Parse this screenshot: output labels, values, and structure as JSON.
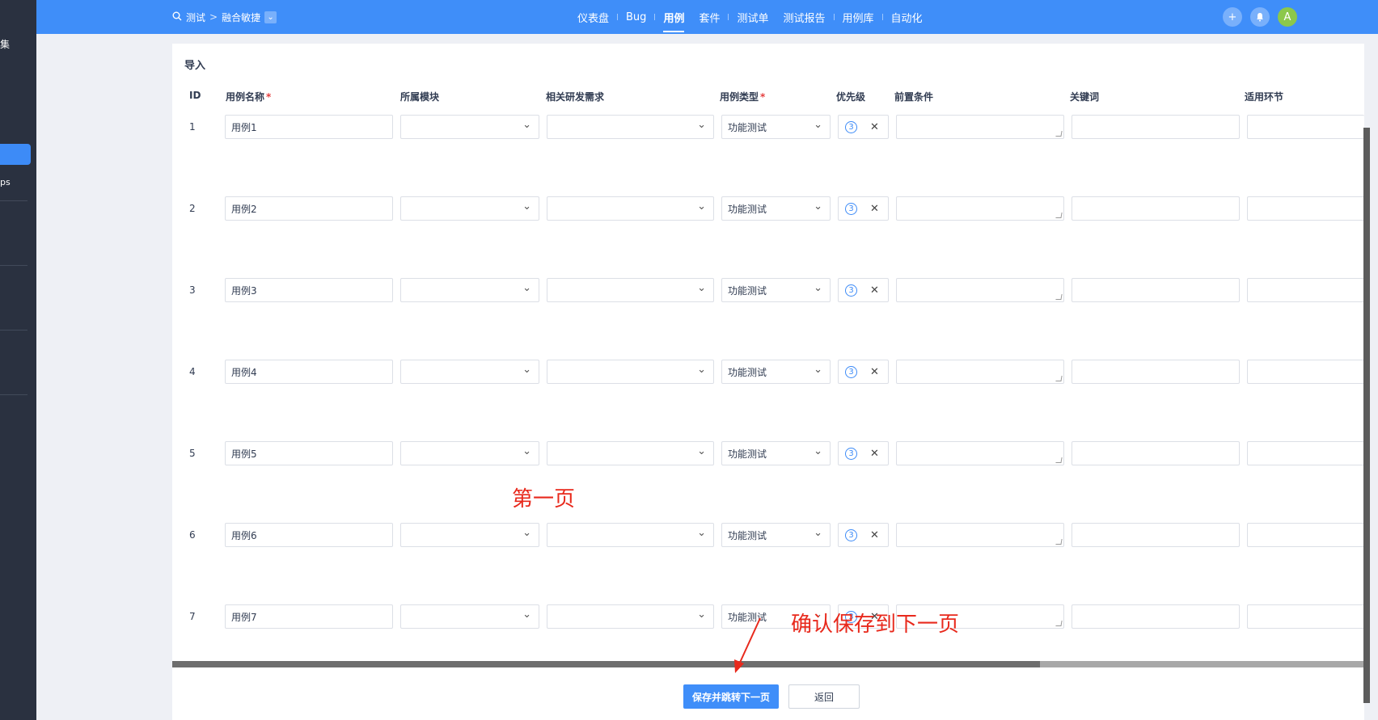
{
  "sidebar": {
    "frag_top": "集",
    "frag_mid": "ps"
  },
  "header": {
    "breadcrumb": {
      "product": "测试",
      "separator": ">",
      "project": "融合敏捷"
    },
    "nav": [
      {
        "label": "仪表盘"
      },
      {
        "label": "Bug"
      },
      {
        "label": "用例",
        "active": true
      },
      {
        "label": "套件"
      },
      {
        "label": "测试单"
      },
      {
        "label": "测试报告"
      },
      {
        "label": "用例库"
      },
      {
        "label": "自动化"
      }
    ],
    "avatar": "A"
  },
  "page": {
    "title": "导入"
  },
  "columns": {
    "id": "ID",
    "name": "用例名称",
    "module": "所属模块",
    "story": "相关研发需求",
    "type": "用例类型",
    "priority": "优先级",
    "precondition": "前置条件",
    "keywords": "关键词",
    "stage": "适用环节",
    "required_mark": "*"
  },
  "rows": [
    {
      "id": "1",
      "name": "用例1",
      "type": "功能测试",
      "priority": "3"
    },
    {
      "id": "2",
      "name": "用例2",
      "type": "功能测试",
      "priority": "3"
    },
    {
      "id": "3",
      "name": "用例3",
      "type": "功能测试",
      "priority": "3"
    },
    {
      "id": "4",
      "name": "用例4",
      "type": "功能测试",
      "priority": "3"
    },
    {
      "id": "5",
      "name": "用例5",
      "type": "功能测试",
      "priority": "3"
    },
    {
      "id": "6",
      "name": "用例6",
      "type": "功能测试",
      "priority": "3"
    },
    {
      "id": "7",
      "name": "用例7",
      "type": "功能测试",
      "priority": "3"
    }
  ],
  "buttons": {
    "save_next": "保存并跳转下一页",
    "back": "返回"
  },
  "annotations": {
    "page_label": "第一页",
    "hint": "确认保存到下一页"
  },
  "colors": {
    "header": "#3f8ef9",
    "sidebar": "#2a3140",
    "annotation": "#e8291c"
  }
}
